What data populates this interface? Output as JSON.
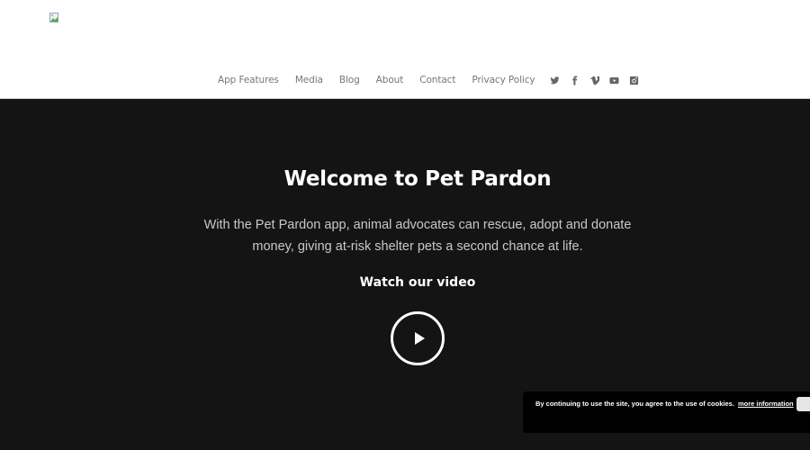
{
  "header": {
    "logo_alt": "broken-image"
  },
  "nav": {
    "items": [
      {
        "label": "App Features"
      },
      {
        "label": "Media"
      },
      {
        "label": "Blog"
      },
      {
        "label": "About"
      },
      {
        "label": "Contact"
      },
      {
        "label": "Privacy Policy"
      }
    ],
    "social": [
      "twitter-icon",
      "facebook-icon",
      "vimeo-icon",
      "youtube-icon",
      "instagram-icon"
    ]
  },
  "hero": {
    "title": "Welcome to Pet Pardon",
    "description_line1": "With the Pet Pardon app, animal advocates can rescue, adopt and donate",
    "description_line2": "money, giving at-risk shelter pets a second chance at life.",
    "watch_label": "Watch our video"
  },
  "cookie": {
    "text": "By continuing to use the site, you agree to the use of cookies.",
    "link": "more information",
    "button_label": ""
  },
  "colors": {
    "header_bg": "#ffffff",
    "hero_bg": "#141414",
    "nav_text": "#777777",
    "cookie_bg": "#000000"
  }
}
